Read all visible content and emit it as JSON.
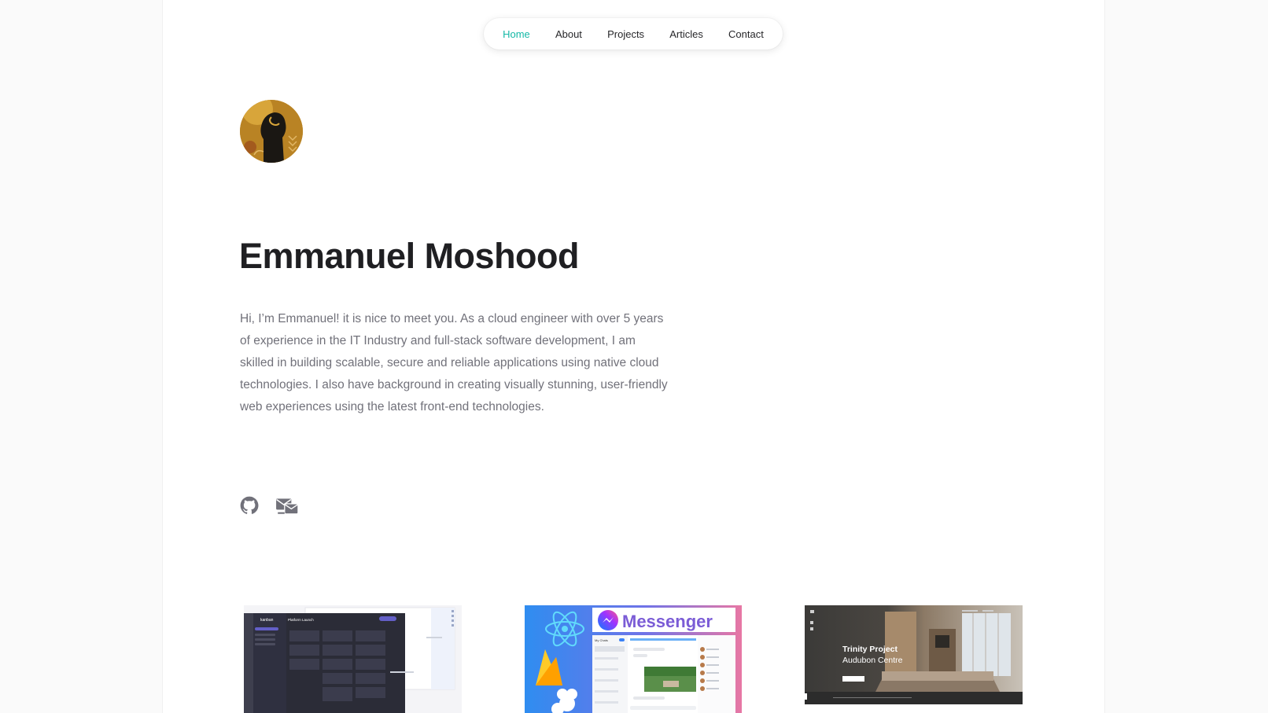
{
  "nav": {
    "items": [
      {
        "label": "Home",
        "active": true
      },
      {
        "label": "About",
        "active": false
      },
      {
        "label": "Projects",
        "active": false
      },
      {
        "label": "Articles",
        "active": false
      },
      {
        "label": "Contact",
        "active": false
      }
    ],
    "accent_color": "#14b8a6"
  },
  "profile": {
    "name": "Emmanuel Moshood",
    "bio": "Hi, I’m Emmanuel! it is nice to meet you. As a cloud engineer with over 5 years of experience in the IT Industry and full-stack software development, I am skilled in building scalable, secure and reliable applications using native cloud technologies. I also have background in creating visually stunning, user-friendly web experiences using the latest front-end technologies."
  },
  "social": [
    {
      "icon": "github-icon"
    },
    {
      "icon": "mail-icon"
    }
  ],
  "projects": [
    {
      "name": "kanban",
      "thumb_title": "kanban",
      "thumb_subtitle": "Platform Launch",
      "thumb_button": "+ Add New Task"
    },
    {
      "name": "messenger",
      "thumb_title": "Messenger",
      "thumb_sidebar": "My Chats"
    },
    {
      "name": "trinity",
      "thumb_title": "Trinity Project",
      "thumb_subtitle": "Audubon Centre"
    }
  ]
}
